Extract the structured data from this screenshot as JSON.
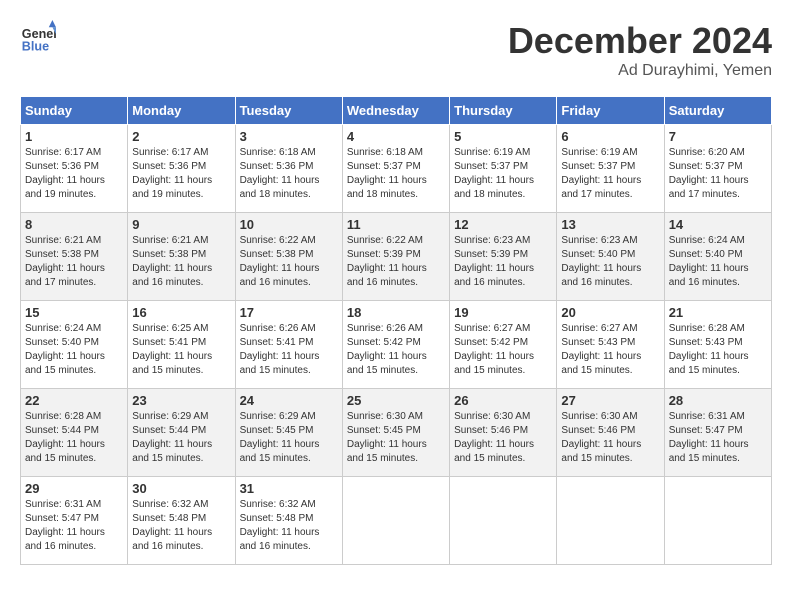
{
  "header": {
    "logo_line1": "General",
    "logo_line2": "Blue",
    "month": "December 2024",
    "location": "Ad Durayhimi, Yemen"
  },
  "weekdays": [
    "Sunday",
    "Monday",
    "Tuesday",
    "Wednesday",
    "Thursday",
    "Friday",
    "Saturday"
  ],
  "weeks": [
    [
      {
        "day": "1",
        "sunrise": "6:17 AM",
        "sunset": "5:36 PM",
        "daylight": "11 hours and 19 minutes."
      },
      {
        "day": "2",
        "sunrise": "6:17 AM",
        "sunset": "5:36 PM",
        "daylight": "11 hours and 19 minutes."
      },
      {
        "day": "3",
        "sunrise": "6:18 AM",
        "sunset": "5:36 PM",
        "daylight": "11 hours and 18 minutes."
      },
      {
        "day": "4",
        "sunrise": "6:18 AM",
        "sunset": "5:37 PM",
        "daylight": "11 hours and 18 minutes."
      },
      {
        "day": "5",
        "sunrise": "6:19 AM",
        "sunset": "5:37 PM",
        "daylight": "11 hours and 18 minutes."
      },
      {
        "day": "6",
        "sunrise": "6:19 AM",
        "sunset": "5:37 PM",
        "daylight": "11 hours and 17 minutes."
      },
      {
        "day": "7",
        "sunrise": "6:20 AM",
        "sunset": "5:37 PM",
        "daylight": "11 hours and 17 minutes."
      }
    ],
    [
      {
        "day": "8",
        "sunrise": "6:21 AM",
        "sunset": "5:38 PM",
        "daylight": "11 hours and 17 minutes."
      },
      {
        "day": "9",
        "sunrise": "6:21 AM",
        "sunset": "5:38 PM",
        "daylight": "11 hours and 16 minutes."
      },
      {
        "day": "10",
        "sunrise": "6:22 AM",
        "sunset": "5:38 PM",
        "daylight": "11 hours and 16 minutes."
      },
      {
        "day": "11",
        "sunrise": "6:22 AM",
        "sunset": "5:39 PM",
        "daylight": "11 hours and 16 minutes."
      },
      {
        "day": "12",
        "sunrise": "6:23 AM",
        "sunset": "5:39 PM",
        "daylight": "11 hours and 16 minutes."
      },
      {
        "day": "13",
        "sunrise": "6:23 AM",
        "sunset": "5:40 PM",
        "daylight": "11 hours and 16 minutes."
      },
      {
        "day": "14",
        "sunrise": "6:24 AM",
        "sunset": "5:40 PM",
        "daylight": "11 hours and 16 minutes."
      }
    ],
    [
      {
        "day": "15",
        "sunrise": "6:24 AM",
        "sunset": "5:40 PM",
        "daylight": "11 hours and 15 minutes."
      },
      {
        "day": "16",
        "sunrise": "6:25 AM",
        "sunset": "5:41 PM",
        "daylight": "11 hours and 15 minutes."
      },
      {
        "day": "17",
        "sunrise": "6:26 AM",
        "sunset": "5:41 PM",
        "daylight": "11 hours and 15 minutes."
      },
      {
        "day": "18",
        "sunrise": "6:26 AM",
        "sunset": "5:42 PM",
        "daylight": "11 hours and 15 minutes."
      },
      {
        "day": "19",
        "sunrise": "6:27 AM",
        "sunset": "5:42 PM",
        "daylight": "11 hours and 15 minutes."
      },
      {
        "day": "20",
        "sunrise": "6:27 AM",
        "sunset": "5:43 PM",
        "daylight": "11 hours and 15 minutes."
      },
      {
        "day": "21",
        "sunrise": "6:28 AM",
        "sunset": "5:43 PM",
        "daylight": "11 hours and 15 minutes."
      }
    ],
    [
      {
        "day": "22",
        "sunrise": "6:28 AM",
        "sunset": "5:44 PM",
        "daylight": "11 hours and 15 minutes."
      },
      {
        "day": "23",
        "sunrise": "6:29 AM",
        "sunset": "5:44 PM",
        "daylight": "11 hours and 15 minutes."
      },
      {
        "day": "24",
        "sunrise": "6:29 AM",
        "sunset": "5:45 PM",
        "daylight": "11 hours and 15 minutes."
      },
      {
        "day": "25",
        "sunrise": "6:30 AM",
        "sunset": "5:45 PM",
        "daylight": "11 hours and 15 minutes."
      },
      {
        "day": "26",
        "sunrise": "6:30 AM",
        "sunset": "5:46 PM",
        "daylight": "11 hours and 15 minutes."
      },
      {
        "day": "27",
        "sunrise": "6:30 AM",
        "sunset": "5:46 PM",
        "daylight": "11 hours and 15 minutes."
      },
      {
        "day": "28",
        "sunrise": "6:31 AM",
        "sunset": "5:47 PM",
        "daylight": "11 hours and 15 minutes."
      }
    ],
    [
      {
        "day": "29",
        "sunrise": "6:31 AM",
        "sunset": "5:47 PM",
        "daylight": "11 hours and 16 minutes."
      },
      {
        "day": "30",
        "sunrise": "6:32 AM",
        "sunset": "5:48 PM",
        "daylight": "11 hours and 16 minutes."
      },
      {
        "day": "31",
        "sunrise": "6:32 AM",
        "sunset": "5:48 PM",
        "daylight": "11 hours and 16 minutes."
      },
      null,
      null,
      null,
      null
    ]
  ]
}
